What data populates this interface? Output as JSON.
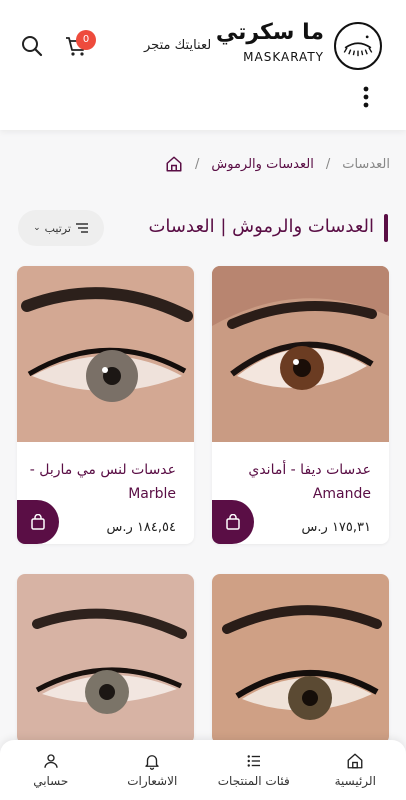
{
  "header": {
    "logo_ar": "ما سكرتي",
    "logo_en": "MASKARATY",
    "store_label": "لعنايتك متجر",
    "cart_count": "0"
  },
  "breadcrumb": {
    "level1": "العدسات والرموش",
    "current": "العدسات"
  },
  "page": {
    "title": "العدسات والرموش | العدسات",
    "sort_label": "ترتيب"
  },
  "products": [
    {
      "name": "عدسات ديفا - أماندي Amande",
      "price": "١٧٥,٣١ ر.س"
    },
    {
      "name": "عدسات لنس مي ماربل -Marble",
      "price": "١٨٤,٥٤ ر.س"
    }
  ],
  "bottom_nav": {
    "home": "الرئيسية",
    "categories": "فئات المنتجات",
    "notifications": "الاشعارات",
    "account": "حسابي"
  },
  "colors": {
    "brand": "#5a0e45",
    "badge": "#ee4b3c"
  }
}
